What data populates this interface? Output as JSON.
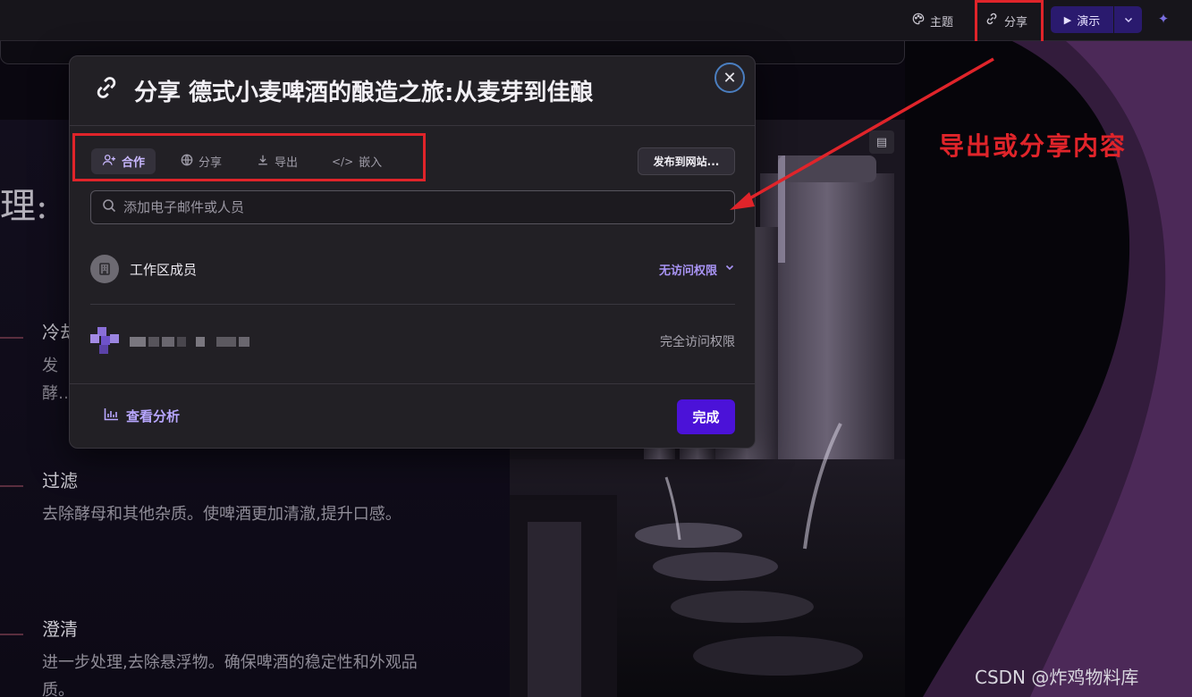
{
  "topbar": {
    "theme_label": "主题",
    "share_label": "分享",
    "present_label": "演示"
  },
  "slide": {
    "title_fragment": "理:",
    "items": [
      {
        "title": "冷却",
        "desc": "发酵…动,"
      },
      {
        "title": "过滤",
        "desc": "去除酵母和其他杂质。使啤酒更加清澈,提升口感。"
      },
      {
        "title": "澄清",
        "desc": "进一步处理,去除悬浮物。确保啤酒的稳定性和外观品质。"
      }
    ]
  },
  "dialog": {
    "title": "分享 德式小麦啤酒的酿造之旅:从麦芽到佳酿",
    "tabs": [
      {
        "label": "合作",
        "icon": "add-user-icon",
        "active": true
      },
      {
        "label": "分享",
        "icon": "globe-icon",
        "active": false
      },
      {
        "label": "导出",
        "icon": "download-icon",
        "active": false
      },
      {
        "label": "嵌入",
        "icon": "code-icon",
        "active": false
      }
    ],
    "publish_label": "发布到网站...",
    "search_placeholder": "添加电子邮件或人员",
    "workspace_member_label": "工作区成员",
    "workspace_permission": "无访问权限",
    "owner_permission": "完全访问权限",
    "analytics_label": "查看分析",
    "done_label": "完成"
  },
  "annotation": {
    "text": "导出或分享内容",
    "color": "#e0242a"
  },
  "watermark": "CSDN @炸鸡物料库",
  "colors": {
    "accent": "#4b12d8",
    "accent_text": "#a994f5",
    "dialog_bg": "#222025"
  }
}
